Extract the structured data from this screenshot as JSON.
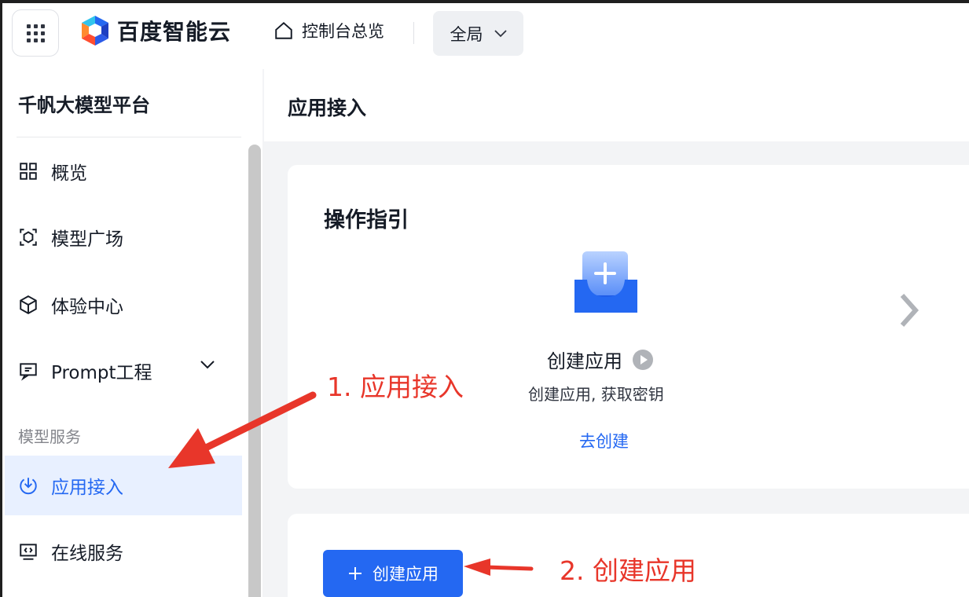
{
  "header": {
    "brand": "百度智能云",
    "home_label": "控制台总览",
    "scope_label": "全局"
  },
  "sidebar": {
    "title": "千帆大模型平台",
    "items": [
      {
        "label": "概览",
        "icon": "grid-icon"
      },
      {
        "label": "模型广场",
        "icon": "cube-scan-icon"
      },
      {
        "label": "体验中心",
        "icon": "box-3d-icon"
      },
      {
        "label": "Prompt工程",
        "icon": "message-code-icon"
      }
    ],
    "group_label": "模型服务",
    "group_items": [
      {
        "label": "应用接入",
        "icon": "download-circle-icon",
        "active": true
      },
      {
        "label": "在线服务",
        "icon": "code-window-icon"
      }
    ]
  },
  "main": {
    "title": "应用接入",
    "guide": {
      "title": "操作指引",
      "step_name": "创建应用",
      "step_desc": "创建应用, 获取密钥",
      "step_link": "去创建"
    },
    "create_button": "创建应用"
  },
  "annotations": {
    "step1": "1. 应用接入",
    "step2": "2. 创建应用"
  },
  "colors": {
    "primary": "#2468f2",
    "annotation": "#e8362a",
    "active_bg": "#e8f0ff"
  }
}
